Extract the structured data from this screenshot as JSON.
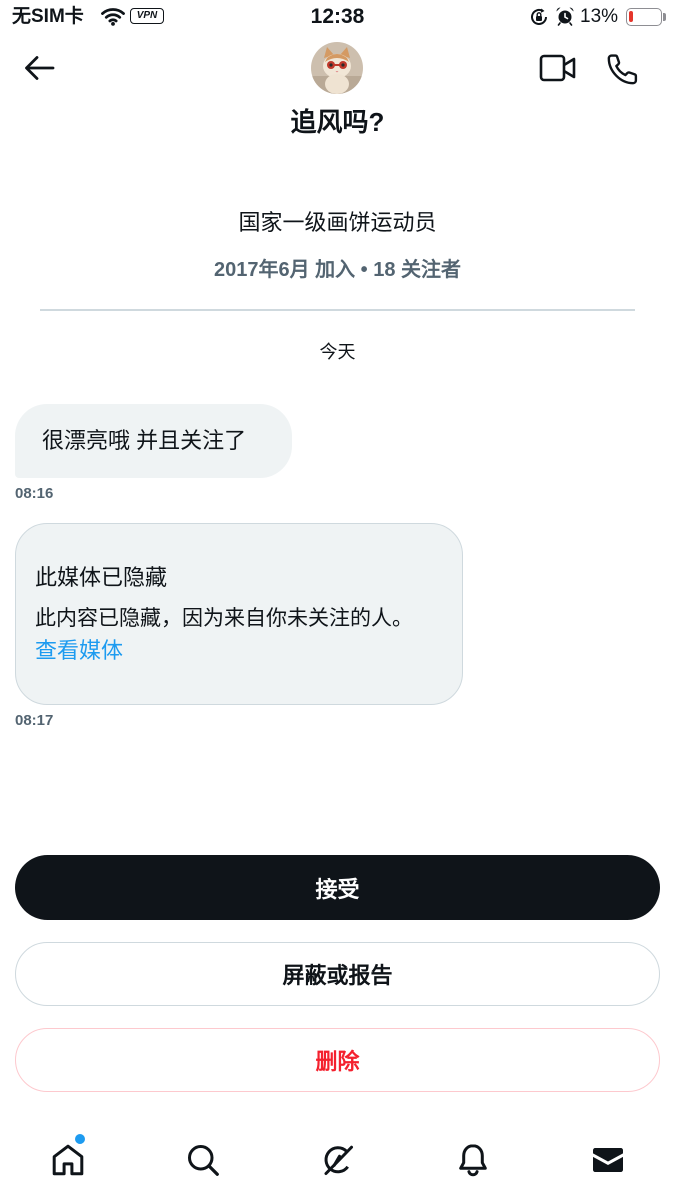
{
  "status_bar": {
    "carrier": "无SIM卡",
    "vpn": "VPN",
    "time": "12:38",
    "battery": "13%",
    "battery_level_percent": 13,
    "icons": [
      "wifi-icon",
      "rotation-lock-icon",
      "alarm-icon",
      "battery-icon"
    ]
  },
  "header": {
    "title": "追风吗?",
    "back_icon": "back-arrow-icon",
    "video_icon": "video-call-icon",
    "phone_icon": "phone-icon"
  },
  "profile": {
    "bio": "国家一级画饼运动员",
    "meta": "2017年6月 加入 • 18 关注者"
  },
  "conversation": {
    "date_separator": "今天",
    "messages": [
      {
        "type": "text",
        "text": "很漂亮哦 并且关注了",
        "time": "08:16"
      },
      {
        "type": "hidden_media",
        "title": "此媒体已隐藏",
        "body": "此内容已隐藏，因为来自你未关注的人。",
        "link": "查看媒体",
        "time": "08:17"
      }
    ]
  },
  "actions": {
    "accept": "接受",
    "block_or_report": "屏蔽或报告",
    "delete": "删除"
  },
  "bottom_nav": {
    "items": [
      {
        "icon": "home-icon",
        "badge_dot": true
      },
      {
        "icon": "search-icon"
      },
      {
        "icon": "grok-icon"
      },
      {
        "icon": "bell-icon"
      },
      {
        "icon": "mail-icon",
        "active": true
      }
    ]
  },
  "colors": {
    "text": "#0f1419",
    "secondary": "#536471",
    "accent": "#1d9bf0",
    "danger": "#f4212e",
    "bubble": "#eff3f4",
    "border": "#cfd9de",
    "battery_low": "#e5352b"
  }
}
